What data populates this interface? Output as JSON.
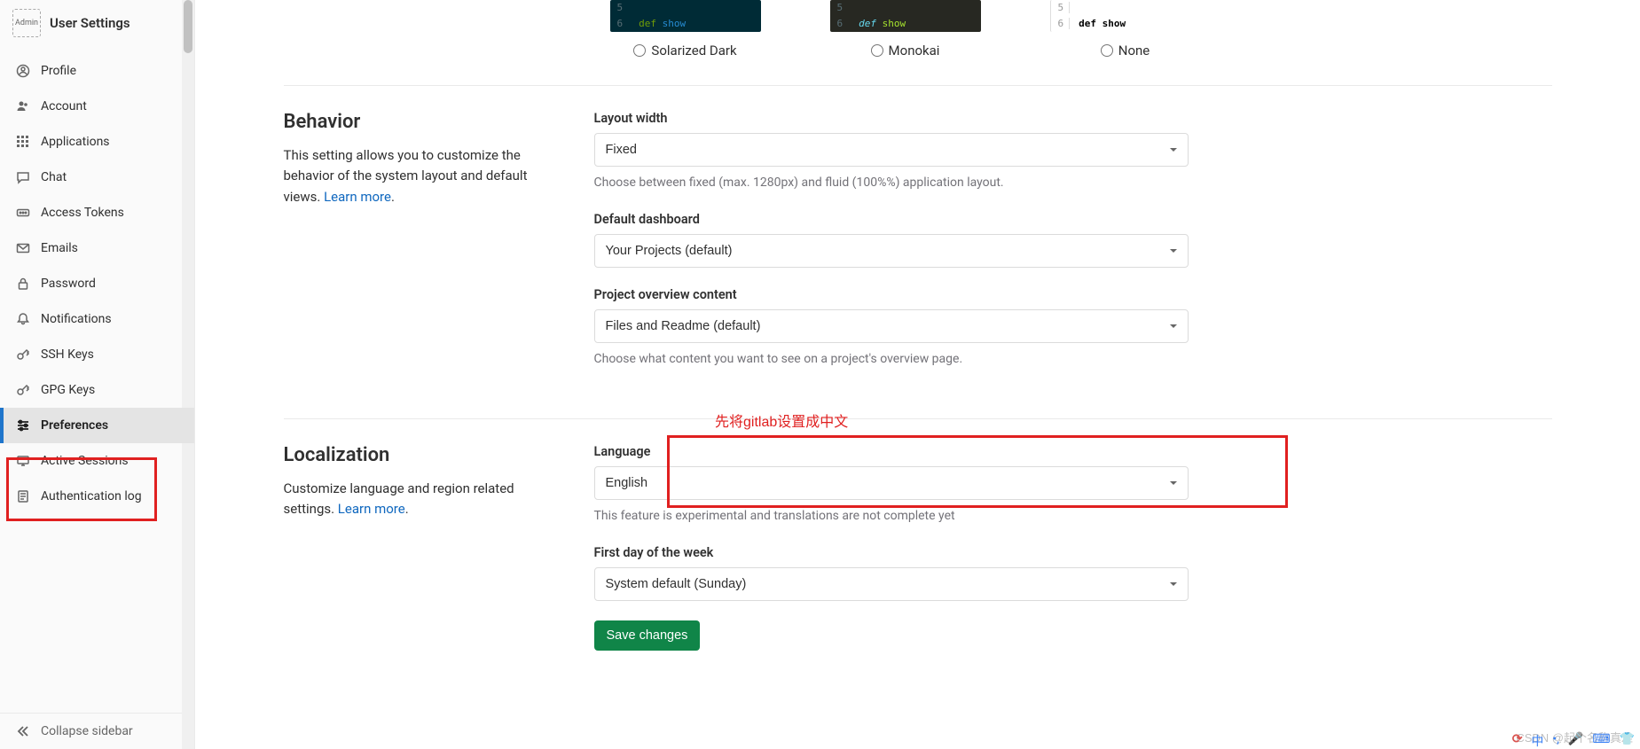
{
  "sidebar": {
    "avatar_alt": "Admin",
    "title": "User Settings",
    "items": [
      {
        "label": "Profile"
      },
      {
        "label": "Account"
      },
      {
        "label": "Applications"
      },
      {
        "label": "Chat"
      },
      {
        "label": "Access Tokens"
      },
      {
        "label": "Emails"
      },
      {
        "label": "Password"
      },
      {
        "label": "Notifications"
      },
      {
        "label": "SSH Keys"
      },
      {
        "label": "GPG Keys"
      },
      {
        "label": "Preferences"
      },
      {
        "label": "Active Sessions"
      },
      {
        "label": "Authentication log"
      }
    ],
    "collapse": "Collapse sidebar"
  },
  "themes": {
    "code_line5": "5",
    "code_line6": "6",
    "code_kw": "def",
    "code_fn": "show",
    "options": [
      {
        "label": "Solarized Dark"
      },
      {
        "label": "Monokai"
      },
      {
        "label": "None"
      }
    ]
  },
  "behavior": {
    "title": "Behavior",
    "desc": "This setting allows you to customize the behavior of the system layout and default views. ",
    "learn_more": "Learn more",
    "layout_width_label": "Layout width",
    "layout_width_value": "Fixed",
    "layout_width_help": "Choose between fixed (max. 1280px) and fluid (100%%) application layout.",
    "dashboard_label": "Default dashboard",
    "dashboard_value": "Your Projects (default)",
    "overview_label": "Project overview content",
    "overview_value": "Files and Readme (default)",
    "overview_help": "Choose what content you want to see on a project's overview page."
  },
  "localization": {
    "title": "Localization",
    "desc": "Customize language and region related settings. ",
    "learn_more": "Learn more",
    "language_label": "Language",
    "language_value": "English",
    "language_help": "This feature is experimental and translations are not complete yet",
    "first_day_label": "First day of the week",
    "first_day_value": "System default (Sunday)",
    "save": "Save changes"
  },
  "annotation": "先将gitlab设置成中文",
  "watermark": "CSDN @起个名称真难"
}
